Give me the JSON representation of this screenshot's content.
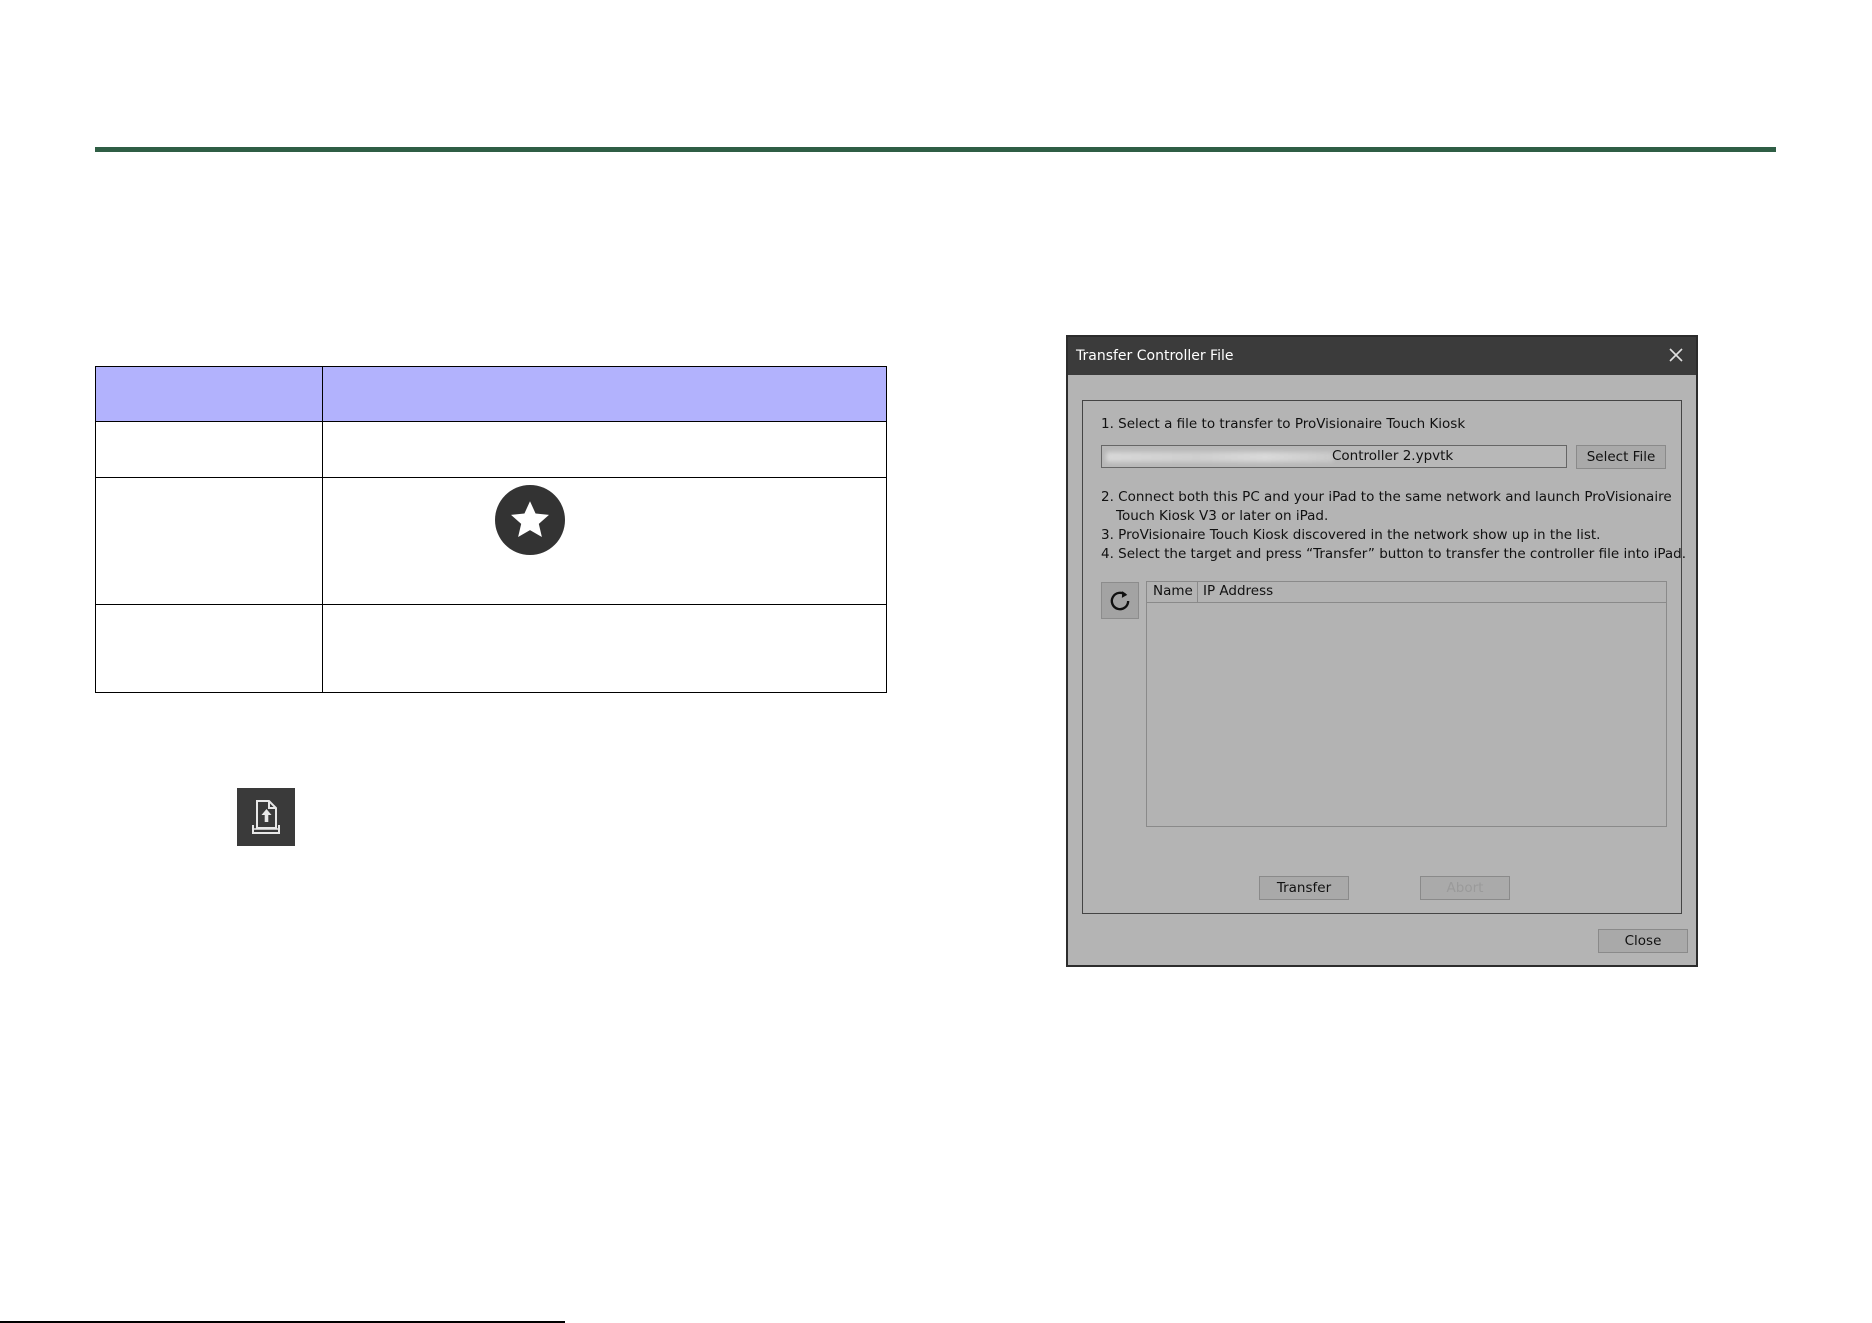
{
  "dialog": {
    "title": "Transfer Controller File",
    "step1": "1. Select a file to transfer to ProVisionaire Touch Kiosk",
    "file_path_visible": "Controller 2.ypvtk",
    "select_file_label": "Select File",
    "step2a": "2. Connect both this PC and your iPad to the same network and launch ProVisionaire",
    "step2b": "Touch Kiosk V3 or later on iPad.",
    "step3": "3. ProVisionaire Touch Kiosk discovered in the network show up in the list.",
    "step4": "4. Select the target and press “Transfer” button to transfer the controller file into iPad.",
    "list_columns": [
      "Name",
      "IP Address"
    ],
    "transfer_label": "Transfer",
    "abort_label": "Abort",
    "close_label": "Close"
  },
  "icons": {
    "star": "star-badge-icon",
    "upload": "upload-file-icon",
    "refresh": "refresh-icon",
    "close": "close-icon"
  },
  "colors": {
    "rule": "#2f5e45",
    "table_header": "#b2b2fd",
    "dialog_bg": "#b4b4b4",
    "titlebar": "#3b3b3b"
  }
}
